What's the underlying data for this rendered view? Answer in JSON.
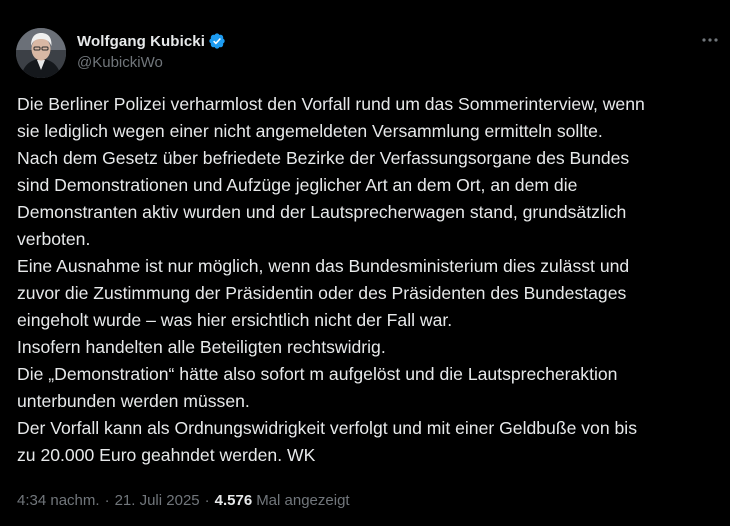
{
  "author": {
    "display_name": "Wolfgang Kubicki",
    "handle": "@KubickiWo",
    "verified": true
  },
  "tweet_lines": [
    "Die Berliner Polizei verharmlost den Vorfall rund um das Sommerinterview, wenn",
    "sie lediglich wegen einer nicht angemeldeten Versammlung ermitteln sollte.",
    "Nach dem Gesetz über befriedete Bezirke der Verfassungsorgane des Bundes",
    "sind Demonstrationen und Aufzüge jeglicher Art an dem Ort, an dem die",
    "Demonstranten aktiv wurden und der Lautsprecherwagen stand, grundsätzlich",
    "verboten.",
    "Eine Ausnahme ist nur möglich, wenn das Bundesministerium dies zulässt und",
    "zuvor die Zustimmung der Präsidentin oder des Präsidenten des Bundestages",
    "eingeholt wurde – was hier ersichtlich nicht der Fall war.",
    "Insofern handelten alle Beteiligten rechtswidrig.",
    "Die „Demonstration“ hätte also sofort m aufgelöst und die Lautsprecheraktion",
    "unterbunden werden müssen.",
    "Der Vorfall kann als Ordnungswidrigkeit verfolgt und mit einer Geldbuße von bis",
    "zu 20.000 Euro geahndet werden. WK"
  ],
  "meta": {
    "time": "4:34 nachm.",
    "separator": "·",
    "date": "21. Juli 2025",
    "views_count": "4.576",
    "views_label": "Mal angezeigt"
  },
  "icons": {
    "verified": "verified-badge-icon",
    "more": "more-horizontal-icon"
  },
  "colors": {
    "background": "#000000",
    "primary_text": "#e7e9ea",
    "secondary_text": "#71767b",
    "verified_blue": "#1d9bf0"
  }
}
